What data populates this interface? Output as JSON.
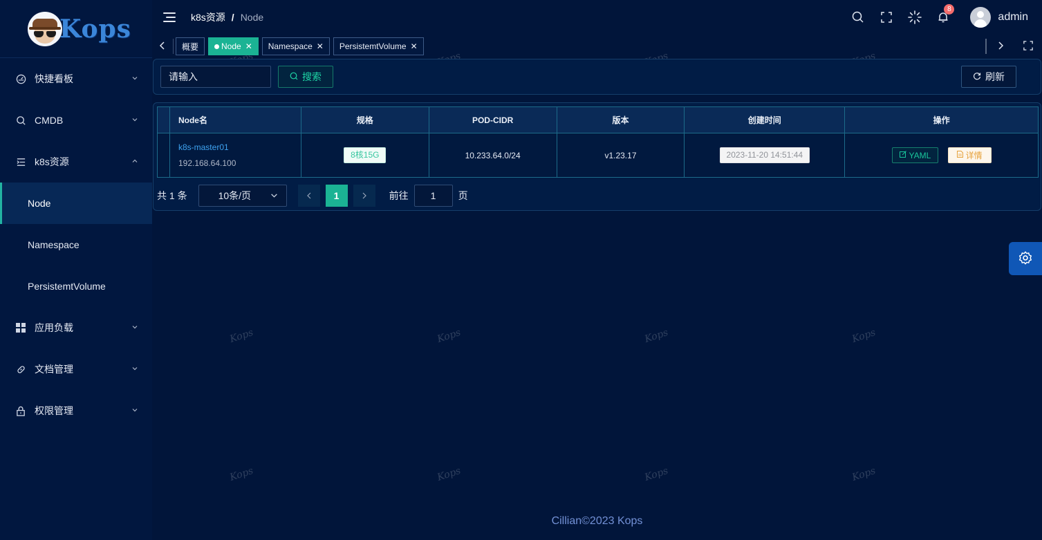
{
  "brand": {
    "logo_text": "Kops"
  },
  "sidebar": {
    "items": [
      {
        "label": "快捷看板",
        "icon": "dashboard-icon",
        "chevron": "down"
      },
      {
        "label": "CMDB",
        "icon": "search-icon",
        "chevron": "down"
      },
      {
        "label": "k8s资源",
        "icon": "list-icon",
        "chevron": "up"
      },
      {
        "label": "应用负载",
        "icon": "grid-icon",
        "chevron": "down"
      },
      {
        "label": "文档管理",
        "icon": "link-icon",
        "chevron": "down"
      },
      {
        "label": "权限管理",
        "icon": "lock-icon",
        "chevron": "down"
      }
    ],
    "subitems": [
      {
        "label": "Node",
        "active": true
      },
      {
        "label": "Namespace",
        "active": false
      },
      {
        "label": "PersistemtVolume",
        "active": false
      }
    ]
  },
  "header": {
    "breadcrumb": [
      "k8s资源",
      "Node"
    ],
    "breadcrumb_sep": "/",
    "notification_count": "8",
    "username": "admin"
  },
  "tags": [
    {
      "label": "概要",
      "active": false,
      "closable": false
    },
    {
      "label": "Node",
      "active": true,
      "closable": true
    },
    {
      "label": "Namespace",
      "active": false,
      "closable": true
    },
    {
      "label": "PersistemtVolume",
      "active": false,
      "closable": true
    }
  ],
  "search": {
    "placeholder": "请输入",
    "search_label": "搜索",
    "refresh_label": "刷新"
  },
  "table": {
    "columns": [
      "Node名",
      "规格",
      "POD-CIDR",
      "版本",
      "创建时间",
      "操作"
    ],
    "rows": [
      {
        "name": "k8s-master01",
        "ip": "192.168.64.100",
        "spec": "8核15G",
        "pod_cidr": "10.233.64.0/24",
        "version": "v1.23.17",
        "created": "2023-11-20 14:51:44",
        "action_yaml": "YAML",
        "action_detail": "详情"
      }
    ]
  },
  "pagination": {
    "total": "共 1 条",
    "page_size": "10条/页",
    "current_page": "1",
    "goto_prefix": "前往",
    "goto_value": "1",
    "goto_suffix": "页"
  },
  "footer": {
    "text": "Cillian©2023 Kops"
  },
  "watermark": {
    "text": "Kops"
  },
  "colors": {
    "accent": "#1bb394",
    "background": "#01153a",
    "link": "#3ea3f1",
    "badge": "#f56c6c"
  }
}
